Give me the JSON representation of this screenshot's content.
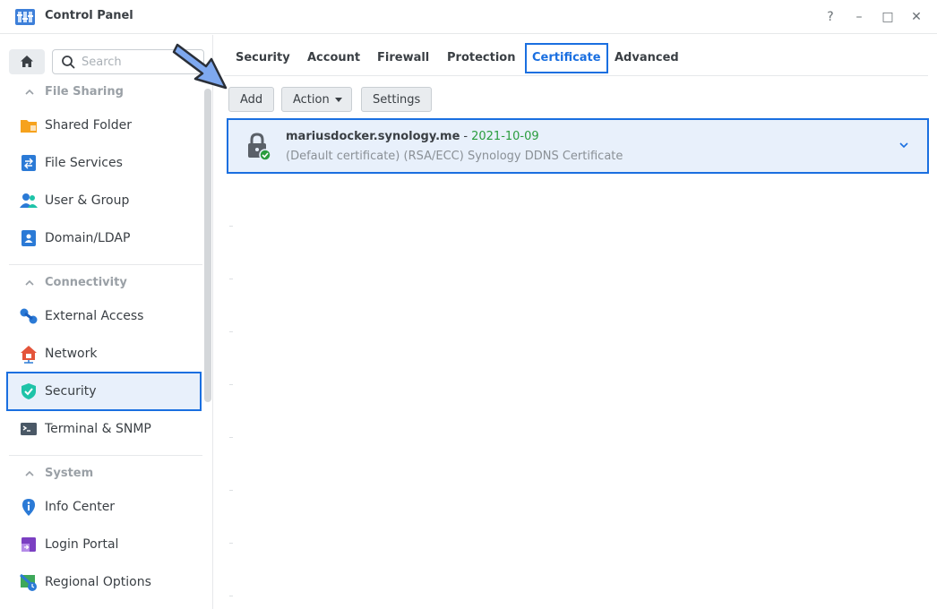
{
  "window": {
    "title": "Control Panel",
    "controls": {
      "help": "?",
      "minimize": "–",
      "maximize": "□",
      "close": "✕"
    }
  },
  "search": {
    "placeholder": "Search"
  },
  "sidebar": {
    "sections": [
      {
        "label": "File Sharing",
        "items": [
          "Shared Folder",
          "File Services",
          "User & Group",
          "Domain/LDAP"
        ]
      },
      {
        "label": "Connectivity",
        "items": [
          "External Access",
          "Network",
          "Security",
          "Terminal & SNMP"
        ]
      },
      {
        "label": "System",
        "items": [
          "Info Center",
          "Login Portal",
          "Regional Options"
        ]
      }
    ],
    "active_item": "Security"
  },
  "tabs": [
    {
      "label": "Security"
    },
    {
      "label": "Account"
    },
    {
      "label": "Firewall"
    },
    {
      "label": "Protection"
    },
    {
      "label": "Certificate",
      "active": true
    },
    {
      "label": "Advanced"
    }
  ],
  "toolbar": {
    "add": "Add",
    "action": "Action",
    "settings": "Settings"
  },
  "certificate": {
    "domain": "mariusdocker.synology.me",
    "separator": "-",
    "date": "2021-10-09",
    "description": "(Default certificate) (RSA/ECC) Synology DDNS Certificate"
  },
  "colors": {
    "accent": "#1a6fe0",
    "date_green": "#2a9c3e",
    "selected_bg": "#e8f0fb"
  }
}
